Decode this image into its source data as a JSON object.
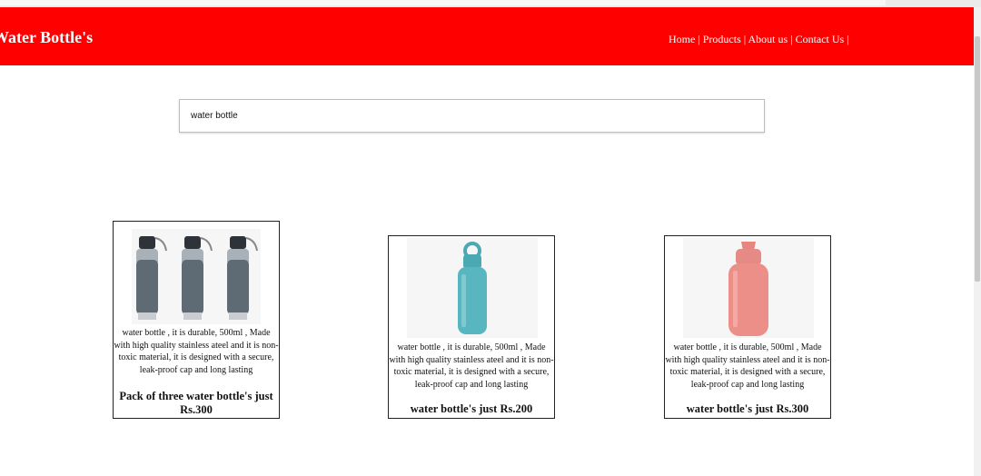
{
  "header": {
    "brand": "Water Bottle's",
    "nav": [
      "Home",
      "Products",
      "About us",
      "Contact Us"
    ],
    "separator": " | "
  },
  "search": {
    "value": "water bottle"
  },
  "products": [
    {
      "description": "water bottle , it is durable, 500ml , Made with high quality stainless ateel and it is non-toxic material, it is designed with a secure, leak-proof cap and long lasting",
      "price_label": "Pack of three water bottle's just Rs.300",
      "image_icon": "grey-bottle-three-pack-icon"
    },
    {
      "description": "water bottle , it is durable, 500ml , Made with high quality stainless ateel and it is non-toxic material, it is designed with a secure, leak-proof cap and long lasting",
      "price_label": "water bottle's just Rs.200",
      "image_icon": "teal-bottle-icon"
    },
    {
      "description": "water bottle , it is durable, 500ml , Made with high quality stainless ateel and it is non-toxic material, it is designed with a secure, leak-proof cap and long lasting",
      "price_label": "water bottle's just Rs.300",
      "image_icon": "pink-bottle-icon"
    }
  ],
  "colors": {
    "header_bg": "#ff0000",
    "header_text": "#ffffff",
    "grey_bottle": "#5f6b74",
    "teal_bottle": "#57b6bf",
    "pink_bottle": "#ec8f89"
  }
}
